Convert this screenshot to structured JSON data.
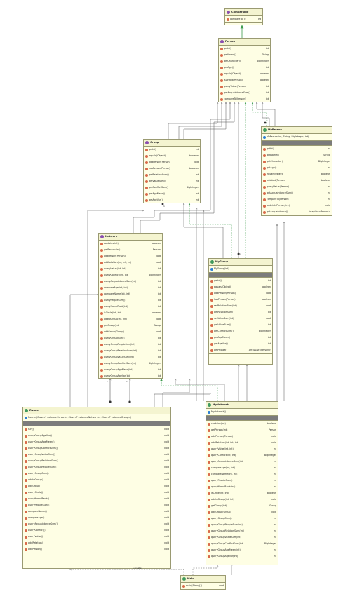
{
  "classes": {
    "comparable": {
      "name": "Comparable",
      "kind": "interface",
      "methods": [
        {
          "sig": "compareTo(T)",
          "ret": "int"
        }
      ]
    },
    "person": {
      "name": "Person",
      "kind": "interface",
      "methods": [
        {
          "sig": "getId()",
          "ret": "int"
        },
        {
          "sig": "getName()",
          "ret": "String"
        },
        {
          "sig": "getCharacter()",
          "ret": "BigInteger"
        },
        {
          "sig": "getAge()",
          "ret": "int"
        },
        {
          "sig": "equals(Object)",
          "ret": "boolean"
        },
        {
          "sig": "isLinked(Person)",
          "ret": "boolean"
        },
        {
          "sig": "queryValue(Person)",
          "ret": "int"
        },
        {
          "sig": "getAcquaintanceSum()",
          "ret": "int"
        },
        {
          "sig": "compareTo(Person)",
          "ret": "int"
        }
      ]
    },
    "group": {
      "name": "Group",
      "kind": "interface",
      "methods": [
        {
          "sig": "getId()",
          "ret": "int"
        },
        {
          "sig": "equals(Object)",
          "ret": "boolean"
        },
        {
          "sig": "addPerson(Person)",
          "ret": "void"
        },
        {
          "sig": "hasPerson(Person)",
          "ret": "boolean"
        },
        {
          "sig": "getRelationSum()",
          "ret": "int"
        },
        {
          "sig": "getValueSum()",
          "ret": "int"
        },
        {
          "sig": "getConflictSum()",
          "ret": "BigInteger"
        },
        {
          "sig": "getAgeMean()",
          "ret": "int"
        },
        {
          "sig": "getAgeVar()",
          "ret": "int"
        }
      ]
    },
    "myperson": {
      "name": "MyPerson",
      "kind": "class",
      "ctor": "MyPerson(int, String, BigInteger, int)",
      "methods": [
        {
          "sig": "getId()",
          "ret": "int"
        },
        {
          "sig": "getName()",
          "ret": "String"
        },
        {
          "sig": "getCharacter()",
          "ret": "BigInteger"
        },
        {
          "sig": "getAge()",
          "ret": "int"
        },
        {
          "sig": "equals(Object)",
          "ret": "boolean"
        },
        {
          "sig": "isLinked(Person)",
          "ret": "boolean"
        },
        {
          "sig": "queryValue(Person)",
          "ret": "int"
        },
        {
          "sig": "getAcquaintanceSum()",
          "ret": "int"
        },
        {
          "sig": "compareTo(Person)",
          "ret": "int"
        },
        {
          "sig": "addLink(Person, int)",
          "ret": "void"
        },
        {
          "sig": "getAcquaintance()",
          "ret": "ArrayList<Person>"
        }
      ]
    },
    "network": {
      "name": "Network",
      "kind": "interface",
      "methods": [
        {
          "sig": "contains(int)",
          "ret": "boolean"
        },
        {
          "sig": "getPerson(int)",
          "ret": "Person"
        },
        {
          "sig": "addPerson(Person)",
          "ret": "void"
        },
        {
          "sig": "addRelation(int, int, int)",
          "ret": "void"
        },
        {
          "sig": "queryValue(int, int)",
          "ret": "int"
        },
        {
          "sig": "queryConflict(int, int)",
          "ret": "BigInteger"
        },
        {
          "sig": "queryAcquaintanceSum(int)",
          "ret": "int"
        },
        {
          "sig": "compareAge(int, int)",
          "ret": "int"
        },
        {
          "sig": "compareName(int, int)",
          "ret": "int"
        },
        {
          "sig": "queryPeopleSum()",
          "ret": "int"
        },
        {
          "sig": "queryNameRank(int)",
          "ret": "int"
        },
        {
          "sig": "isCircle(int, int)",
          "ret": "boolean"
        },
        {
          "sig": "addtoGroup(int, int)",
          "ret": "void"
        },
        {
          "sig": "getGroup(int)",
          "ret": "Group"
        },
        {
          "sig": "addGroup(Group)",
          "ret": "void"
        },
        {
          "sig": "queryGroupSum()",
          "ret": "int"
        },
        {
          "sig": "queryGroupPeopleSum(int)",
          "ret": "int"
        },
        {
          "sig": "queryGroupRelationSum(int)",
          "ret": "int"
        },
        {
          "sig": "queryGroupValueSum(int)",
          "ret": "int"
        },
        {
          "sig": "queryGroupConflictSum(int)",
          "ret": "BigInteger"
        },
        {
          "sig": "queryGroupAgeMean(int)",
          "ret": "int"
        },
        {
          "sig": "queryGroupAgeVar(int)",
          "ret": "int"
        }
      ]
    },
    "mygroup": {
      "name": "MyGroup",
      "kind": "class",
      "ctor": "MyGroup(int)",
      "methods": [
        {
          "sig": "getId()",
          "ret": "int"
        },
        {
          "sig": "equals(Object)",
          "ret": "boolean"
        },
        {
          "sig": "addPerson(Person)",
          "ret": "void"
        },
        {
          "sig": "hasPerson(Person)",
          "ret": "boolean"
        },
        {
          "sig": "setRelationSum(int)",
          "ret": "void"
        },
        {
          "sig": "getRelationSum()",
          "ret": "int"
        },
        {
          "sig": "setValueSum(int)",
          "ret": "void"
        },
        {
          "sig": "getValueSum()",
          "ret": "int"
        },
        {
          "sig": "getConflictSum()",
          "ret": "BigInteger"
        },
        {
          "sig": "getAgeMean()",
          "ret": "int"
        },
        {
          "sig": "getAgeVar()",
          "ret": "int"
        },
        {
          "sig": "getPeople()",
          "ret": "ArrayList<Person>"
        }
      ]
    },
    "runner": {
      "name": "Runner",
      "kind": "class",
      "ctor": "Runner(Class<? extends Person>, Class<? extends Network>, Class<? extends Group>)",
      "methods": [
        {
          "sig": "run()",
          "ret": "void"
        },
        {
          "sig": "queryGroupAgeVar()",
          "ret": "void"
        },
        {
          "sig": "queryGroupAgeMean()",
          "ret": "void"
        },
        {
          "sig": "queryGroupConflictSum()",
          "ret": "void"
        },
        {
          "sig": "queryGroupValueSum()",
          "ret": "void"
        },
        {
          "sig": "queryGroupRelationSum()",
          "ret": "void"
        },
        {
          "sig": "queryGroupPeopleSum()",
          "ret": "void"
        },
        {
          "sig": "queryGroupSum()",
          "ret": "void"
        },
        {
          "sig": "addtoGroup()",
          "ret": "void"
        },
        {
          "sig": "addGroup()",
          "ret": "void"
        },
        {
          "sig": "queryCircle()",
          "ret": "void"
        },
        {
          "sig": "queryNameRank()",
          "ret": "void"
        },
        {
          "sig": "queryPeopleSum()",
          "ret": "void"
        },
        {
          "sig": "compareName()",
          "ret": "void"
        },
        {
          "sig": "compareAge()",
          "ret": "void"
        },
        {
          "sig": "queryAcquaintanceSum()",
          "ret": "void"
        },
        {
          "sig": "queryConflict()",
          "ret": "void"
        },
        {
          "sig": "queryValue()",
          "ret": "void"
        },
        {
          "sig": "addRelation()",
          "ret": "void"
        },
        {
          "sig": "addPerson()",
          "ret": "void"
        }
      ]
    },
    "mynetwork": {
      "name": "MyNetwork",
      "kind": "class",
      "ctor": "MyNetwork()",
      "methods": [
        {
          "sig": "contains(int)",
          "ret": "boolean"
        },
        {
          "sig": "getPerson(int)",
          "ret": "Person"
        },
        {
          "sig": "addPerson(Person)",
          "ret": "void"
        },
        {
          "sig": "addRelation(int, int, int)",
          "ret": "void"
        },
        {
          "sig": "queryValue(int, int)",
          "ret": "int"
        },
        {
          "sig": "queryConflict(int, int)",
          "ret": "BigInteger"
        },
        {
          "sig": "queryAcquaintanceSum(int)",
          "ret": "int"
        },
        {
          "sig": "compareAge(int, int)",
          "ret": "int"
        },
        {
          "sig": "compareName(int, int)",
          "ret": "int"
        },
        {
          "sig": "queryPeopleSum()",
          "ret": "int"
        },
        {
          "sig": "queryNameRank(int)",
          "ret": "int"
        },
        {
          "sig": "isCircle(int, int)",
          "ret": "boolean"
        },
        {
          "sig": "addtoGroup(int, int)",
          "ret": "void"
        },
        {
          "sig": "getGroup(int)",
          "ret": "Group"
        },
        {
          "sig": "addGroup(Group)",
          "ret": "void"
        },
        {
          "sig": "queryGroupSum()",
          "ret": "int"
        },
        {
          "sig": "queryGroupPeopleSum(int)",
          "ret": "int"
        },
        {
          "sig": "queryGroupRelationSum(int)",
          "ret": "int"
        },
        {
          "sig": "queryGroupValueSum(int)",
          "ret": "int"
        },
        {
          "sig": "queryGroupConflictSum(int)",
          "ret": "BigInteger"
        },
        {
          "sig": "queryGroupAgeMean(int)",
          "ret": "int"
        },
        {
          "sig": "queryGroupAgeVar(int)",
          "ret": "int"
        }
      ]
    },
    "main": {
      "name": "Main",
      "kind": "class",
      "methods": [
        {
          "sig": "main(String[])",
          "ret": "void"
        }
      ]
    }
  },
  "labels": {
    "create": "«create»",
    "mult_one": "1",
    "mult_many": "*"
  },
  "colors": {
    "box_fill": "#fefee4",
    "box_border": "#9a9a72",
    "realize": "#3a9a4a",
    "depend": "#555555"
  }
}
